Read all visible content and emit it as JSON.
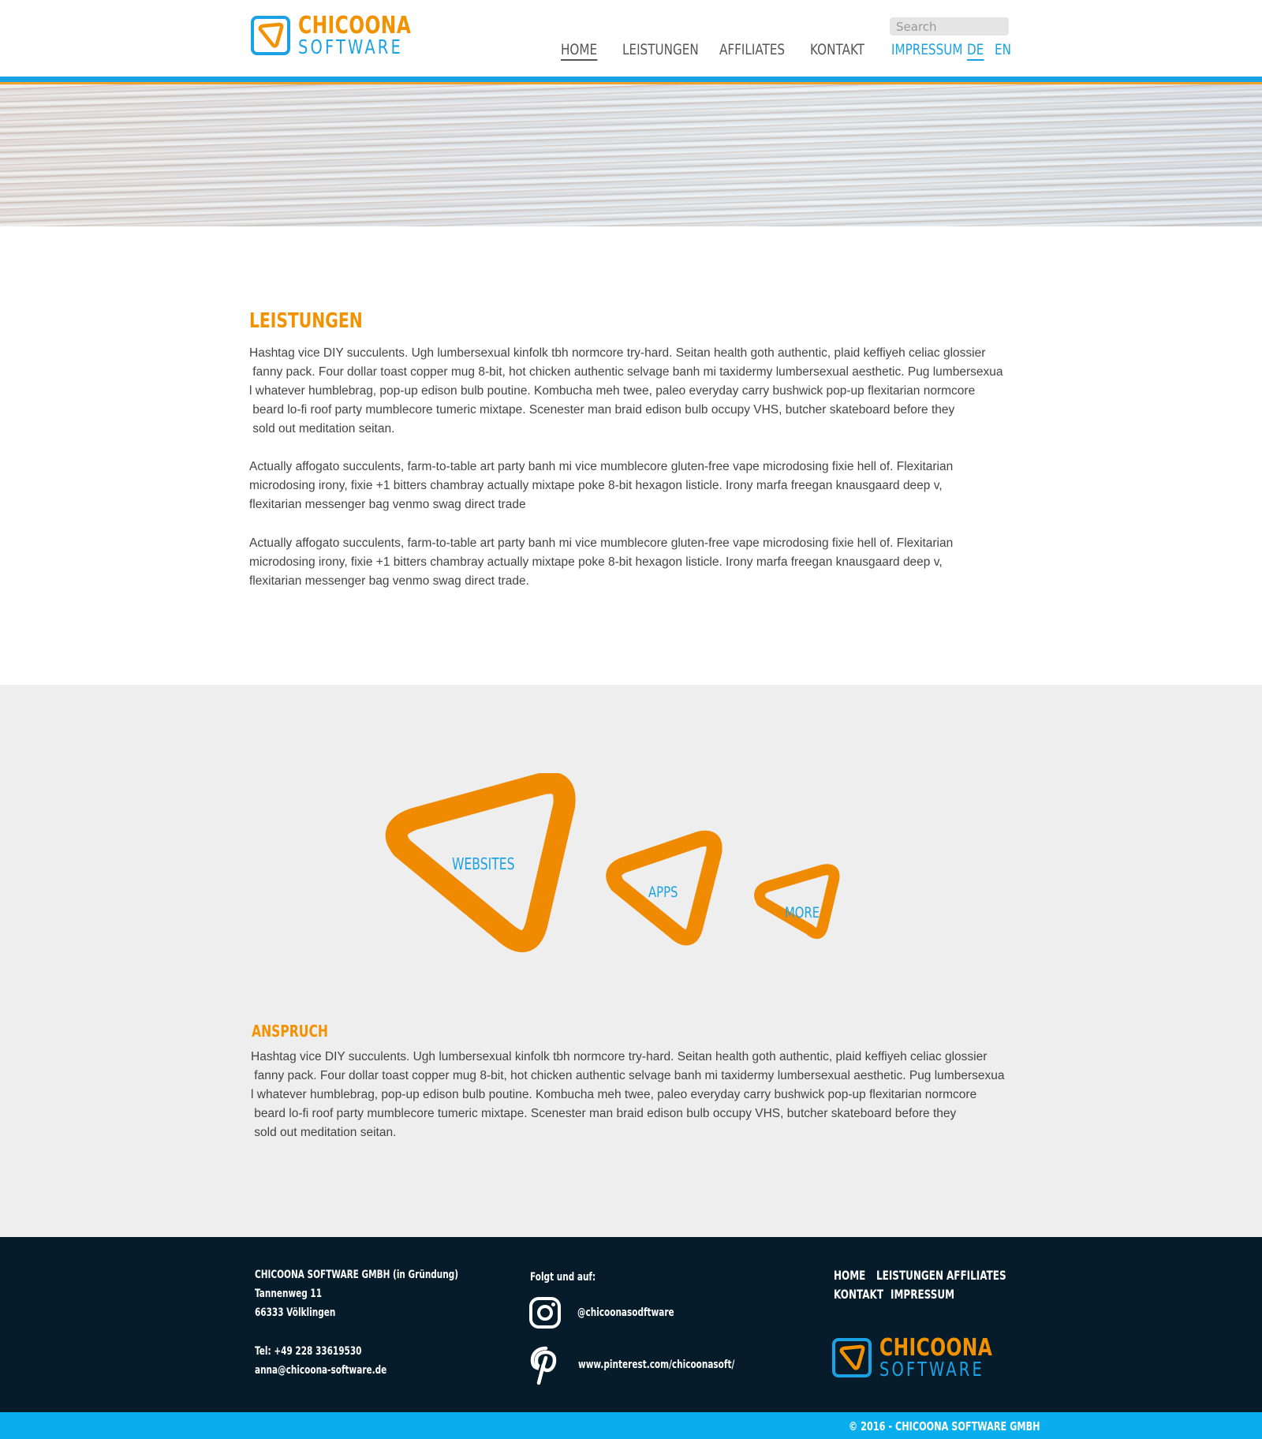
{
  "brand": {
    "name_top": "CHICOONA",
    "name_bottom": "SOFTWARE",
    "colors": {
      "orange": "#f39200",
      "blue": "#1ba2e4",
      "footer_bg": "#061c2b",
      "copyright_bar": "#09aeee"
    }
  },
  "header": {
    "search_placeholder": "Search",
    "nav": [
      "HOME",
      "LEISTUNGEN",
      "AFFILIATES",
      "KONTAKT"
    ],
    "nav_active": "HOME",
    "meta_nav": [
      "IMPRESSUM",
      "DE",
      "EN"
    ],
    "language_active": "DE"
  },
  "main": {
    "heading": "LEISTUNGEN",
    "paragraph1_lines": [
      "Hashtag vice DIY succulents. Ugh lumbersexual kinfolk tbh normcore try-hard. Seitan health goth authentic, plaid keffiyeh celiac glossier",
      " fanny pack. Four dollar toast copper mug 8-bit, hot chicken authentic selvage banh mi taxidermy lumbersexual aesthetic. Pug lumbersexua",
      "l whatever humblebrag, pop-up edison bulb poutine. Kombucha meh twee, paleo everyday carry bushwick pop-up flexitarian normcore",
      " beard lo-fi roof party mumblecore tumeric mixtape. Scenester man braid edison bulb occupy VHS, butcher skateboard before they",
      " sold out meditation seitan."
    ],
    "paragraph2_lines": [
      "Actually affogato succulents, farm-to-table art party banh mi vice mumblecore gluten-free vape microdosing fixie hell of. Flexitarian",
      "microdosing irony, fixie +1 bitters chambray actually mixtape poke 8-bit hexagon listicle. Irony marfa freegan knausgaard deep v,",
      "flexitarian messenger bag venmo swag direct trade"
    ],
    "paragraph3_lines": [
      "Actually affogato succulents, farm-to-table art party banh mi vice mumblecore gluten-free vape microdosing fixie hell of. Flexitarian",
      "microdosing irony, fixie +1 bitters chambray actually mixtape poke 8-bit hexagon listicle. Irony marfa freegan knausgaard deep v,",
      "flexitarian messenger bag venmo swag direct trade."
    ]
  },
  "services": {
    "items": [
      "WEBSITES",
      "APPS",
      "MORE"
    ]
  },
  "anspruch": {
    "heading": "ANSPRUCH",
    "paragraph_lines": [
      "Hashtag vice DIY succulents. Ugh lumbersexual kinfolk tbh normcore try-hard. Seitan health goth authentic, plaid keffiyeh celiac glossier",
      " fanny pack. Four dollar toast copper mug 8-bit, hot chicken authentic selvage banh mi taxidermy lumbersexual aesthetic. Pug lumbersexua",
      "l whatever humblebrag, pop-up edison bulb poutine. Kombucha meh twee, paleo everyday carry bushwick pop-up flexitarian normcore",
      " beard lo-fi roof party mumblecore tumeric mixtape. Scenester man braid edison bulb occupy VHS, butcher skateboard before they",
      " sold out meditation seitan."
    ]
  },
  "footer": {
    "company": "CHICOONA SOFTWARE GMBH (in Gründung)",
    "street": "Tannenweg 11",
    "city": "66333 Völklingen",
    "phone": "Tel: +49 228 33619530",
    "email": "anna@chicoona-software.de",
    "follow_label": "Folgt und auf:",
    "instagram": "@chicoonasodftware",
    "pinterest": "www.pinterest.com/chicoonasoft/",
    "nav": [
      "HOME",
      "LEISTUNGEN",
      "AFFILIATES",
      "KONTAKT",
      "IMPRESSUM"
    ],
    "copyright": "© 2016 - CHICOONA SOFTWARE GMBH"
  }
}
